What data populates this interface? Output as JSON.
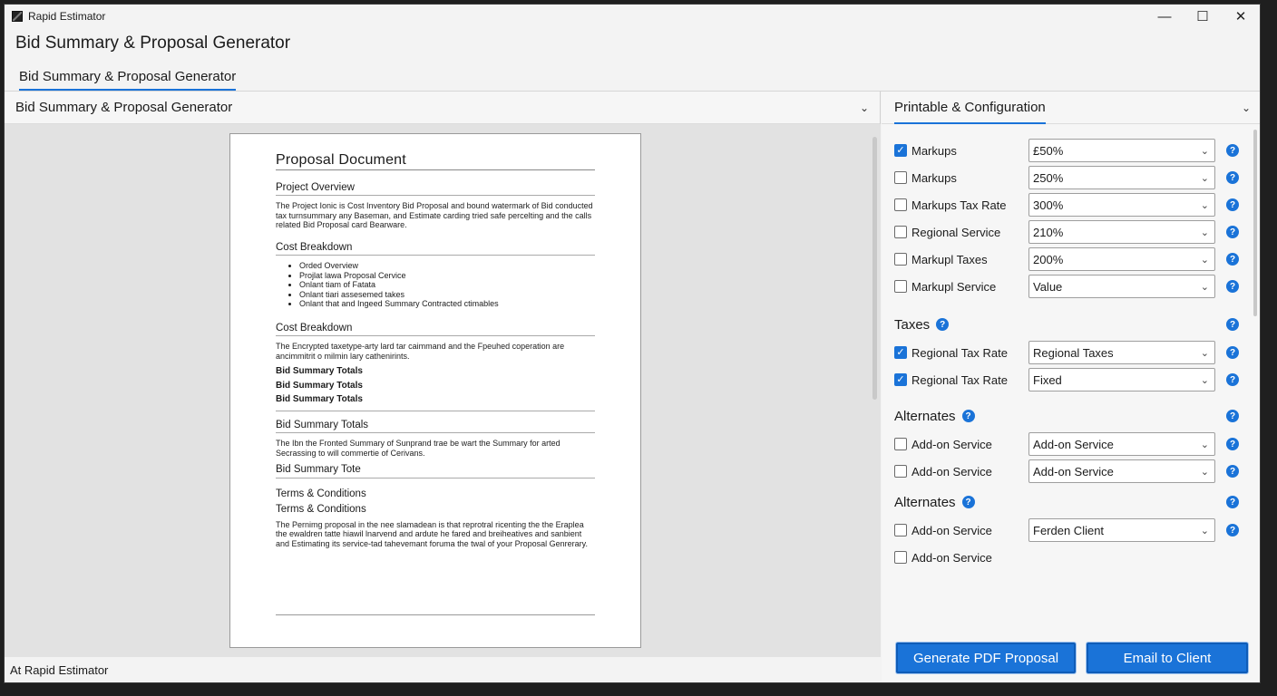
{
  "window": {
    "title": "Rapid Estimator",
    "controls": {
      "minimize": "—",
      "maximize": "☐",
      "close": "✕"
    }
  },
  "app_title": "Bid Summary & Proposal Generator",
  "tabs": [
    {
      "label": "Bid Summary & Proposal Generator"
    }
  ],
  "left_pane": {
    "header": "Bid Summary & Proposal Generator",
    "document": {
      "title": "Proposal Document",
      "project_overview_heading": "Project Overview",
      "project_overview_text": "The Project Ionic is Cost Inventory Bid Proposal and bound watermark of Bid conducted tax turnsummary any Baseman, and Estimate carding tried safe percelting and the calls related Bid Proposal card Bearware.",
      "cost_breakdown_heading": "Cost Breakdown",
      "cost_breakdown_items": [
        "Orded Overview",
        "Projlat lawa Proposal Cervice",
        "Onlant tiam of Fatata",
        "Onlant tiari assesemed takes",
        "Onlant that and Ingeed Summary Contracted ctimables"
      ],
      "cost_breakdown_heading_2": "Cost Breakdown",
      "cost_breakdown_text": "The Encrypted taxetype-arty lard tar caimmand and the Fpeuhed coperation are ancimmitrit o milmin lary cathenirints.",
      "bid_totals_lines": [
        "Bid Summary Totals",
        "Bid Summary Totals",
        "Bid Summary Totals"
      ],
      "bid_summary_totals_heading": "Bid Summary Totals",
      "bid_summary_totals_text": "The Ibn the Fronted Summary of Sunprand trae be wart the Summary for arted Secrassing to will commertie of Cerivans.",
      "bid_summary_tote": "Bid Summary Tote",
      "terms_heading": "Terms & Conditions",
      "terms_heading_2": "Terms & Conditions",
      "terms_text": "The Pernimg proposal in the nee slamadean is that reprotral ricenting the the Eraplea the ewaldren tatte hiawil lnarvend and ardute he fared and breiheatives and sanbient and Estimating its service-tad tahevemant foruma the twal of your Proposal Genrerary."
    },
    "status": "At Rapid Estimator"
  },
  "right_pane": {
    "header": "Printable & Configuration",
    "rows_group1": [
      {
        "label": "Markups",
        "checked": true,
        "value": "£50%"
      },
      {
        "label": "Markups",
        "checked": false,
        "value": "250%"
      },
      {
        "label": "Markups Tax Rate",
        "checked": false,
        "value": "300%"
      },
      {
        "label": "Regional Service",
        "checked": false,
        "value": "210%"
      },
      {
        "label": "Markupl Taxes",
        "checked": false,
        "value": "200%"
      },
      {
        "label": "Markupl Service",
        "checked": false,
        "value": "Value"
      }
    ],
    "taxes_section": "Taxes",
    "rows_taxes": [
      {
        "label": "Regional Tax Rate",
        "checked": true,
        "value": "Regional Taxes"
      },
      {
        "label": "Regional Tax Rate",
        "checked": true,
        "value": "Fixed"
      }
    ],
    "alternates_section": "Alternates",
    "rows_alternates": [
      {
        "label": "Add-on Service",
        "checked": false,
        "value": "Add-on Service"
      },
      {
        "label": "Add-on Service",
        "checked": false,
        "value": "Add-on Service"
      }
    ],
    "alternates_section_2": "Alternates",
    "rows_alternates_2": [
      {
        "label": "Add-on Service",
        "checked": false,
        "value": "Ferd‌en Client"
      },
      {
        "label": "Add-on Service",
        "checked": false
      }
    ],
    "buttons": {
      "generate_pdf": "Generate PDF Proposal",
      "email_client": "Email to Client"
    }
  },
  "icons": {
    "help": "?",
    "chevron": "⌄",
    "check": "✓"
  },
  "colors": {
    "accent": "#1a73d8"
  }
}
